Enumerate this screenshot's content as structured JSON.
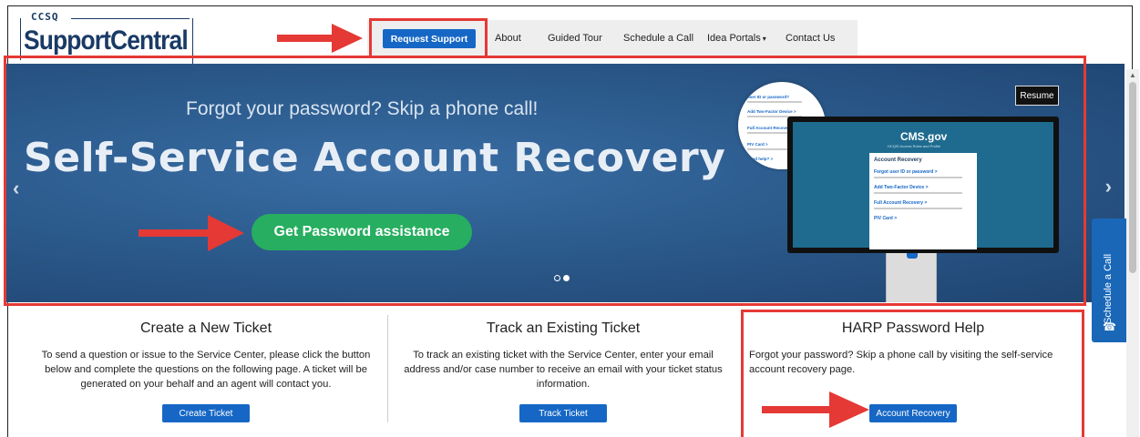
{
  "brand": {
    "small": "CCSQ",
    "name": "SupportCentral"
  },
  "nav": {
    "request_support": "Request Support",
    "items": [
      "About",
      "Guided Tour",
      "Schedule a Call",
      "Idea Portals",
      "Contact Us"
    ],
    "idea_caret": "▾"
  },
  "hero": {
    "subtitle": "Forgot your password? Skip a phone call!",
    "title": "Self-Service Account Recovery",
    "button": "Get Password assistance",
    "resume": "Resume",
    "prev_glyph": "‹",
    "next_glyph": "›",
    "mock": {
      "cms": "CMS.gov",
      "cms_sub": "HCQIS Access Roles and Profile",
      "panel_title": "Account Recovery",
      "links": [
        "Forgot user ID or password >",
        "Add Two-Factor Device >",
        "Full Account Recovery >",
        "PIV Card >"
      ],
      "bubble_links": [
        "user ID or password?",
        "Add Two-Factor Device >",
        "Full Account Recovery >",
        "PIV Card >",
        "Need help? >"
      ]
    }
  },
  "side_tab": {
    "label": "Schedule a Call",
    "icon_glyph": "☎"
  },
  "cards": [
    {
      "title": "Create a New Ticket",
      "text": "To send a question or issue to the Service Center, please click the button below and complete the questions on the following page. A ticket will be generated on your behalf and an agent will contact you.",
      "button": "Create Ticket"
    },
    {
      "title": "Track an Existing Ticket",
      "text": "To track an existing ticket with the Service Center, enter your email address and/or case number to receive an email with your ticket status information.",
      "button": "Track Ticket"
    },
    {
      "title": "HARP Password Help",
      "text": "Forgot your password? Skip a phone call by visiting the self-service account recovery page.",
      "button": "Account Recovery"
    }
  ],
  "colors": {
    "accent_blue": "#1667c5",
    "green": "#27ae60",
    "annotation_red": "#e53935",
    "hero_blue": "#2b5a8c"
  }
}
